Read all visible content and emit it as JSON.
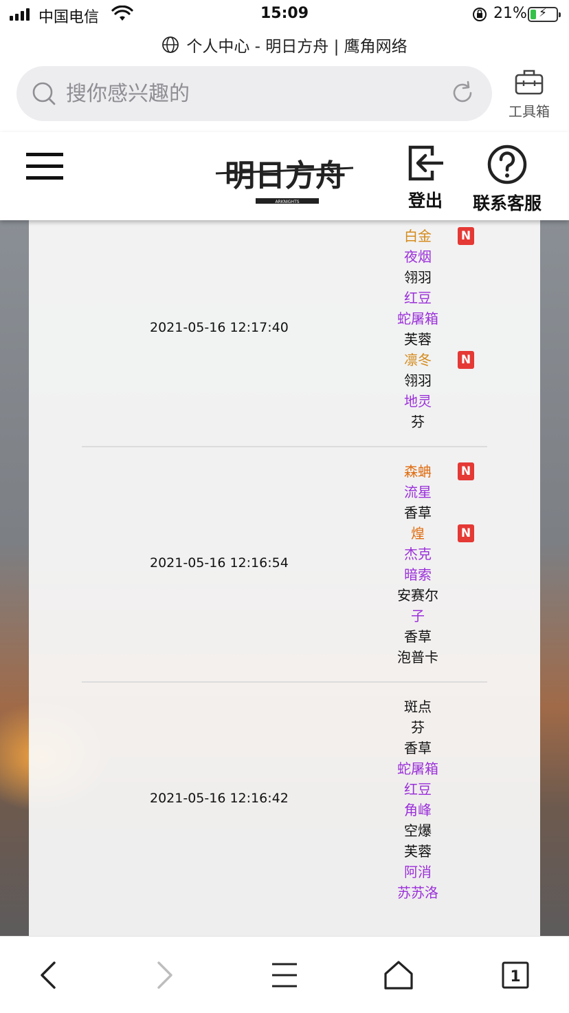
{
  "status_bar": {
    "carrier": "中国电信",
    "time": "15:09",
    "battery": "21%",
    "battery_level": 0.21
  },
  "browser": {
    "page_title": "个人中心 - 明日方舟 | 鹰角网络",
    "search_placeholder": "搜你感兴趣的",
    "toolbox_label": "工具箱"
  },
  "header": {
    "logo_text": "明日方舟",
    "logo_subtext": "ARKNIGHTS",
    "logout_label": "登出",
    "service_label": "联系客服"
  },
  "rarity_colors": {
    "3": "#111111",
    "4": "#9b30d9",
    "5": "#d48a1a",
    "6": "#e06d10"
  },
  "records": [
    {
      "time": "2021-05-16 12:17:40",
      "operators": [
        {
          "name": "白金",
          "rarity": 5,
          "new": true
        },
        {
          "name": "夜烟",
          "rarity": 4,
          "new": false
        },
        {
          "name": "翎羽",
          "rarity": 3,
          "new": false
        },
        {
          "name": "红豆",
          "rarity": 4,
          "new": false
        },
        {
          "name": "蛇屠箱",
          "rarity": 4,
          "new": false
        },
        {
          "name": "芙蓉",
          "rarity": 3,
          "new": false
        },
        {
          "name": "凛冬",
          "rarity": 5,
          "new": true
        },
        {
          "name": "翎羽",
          "rarity": 3,
          "new": false
        },
        {
          "name": "地灵",
          "rarity": 4,
          "new": false
        },
        {
          "name": "芬",
          "rarity": 3,
          "new": false
        }
      ]
    },
    {
      "time": "2021-05-16 12:16:54",
      "operators": [
        {
          "name": "森蚺",
          "rarity": 6,
          "new": true
        },
        {
          "name": "流星",
          "rarity": 4,
          "new": false
        },
        {
          "name": "香草",
          "rarity": 3,
          "new": false
        },
        {
          "name": "煌",
          "rarity": 6,
          "new": true
        },
        {
          "name": "杰克",
          "rarity": 4,
          "new": false
        },
        {
          "name": "暗索",
          "rarity": 4,
          "new": false
        },
        {
          "name": "安赛尔",
          "rarity": 3,
          "new": false
        },
        {
          "name": "子",
          "rarity": 4,
          "new": false
        },
        {
          "name": "香草",
          "rarity": 3,
          "new": false
        },
        {
          "name": "泡普卡",
          "rarity": 3,
          "new": false
        }
      ]
    },
    {
      "time": "2021-05-16 12:16:42",
      "operators": [
        {
          "name": "斑点",
          "rarity": 3,
          "new": false
        },
        {
          "name": "芬",
          "rarity": 3,
          "new": false
        },
        {
          "name": "香草",
          "rarity": 3,
          "new": false
        },
        {
          "name": "蛇屠箱",
          "rarity": 4,
          "new": false
        },
        {
          "name": "红豆",
          "rarity": 4,
          "new": false
        },
        {
          "name": "角峰",
          "rarity": 4,
          "new": false
        },
        {
          "name": "空爆",
          "rarity": 3,
          "new": false
        },
        {
          "name": "芙蓉",
          "rarity": 3,
          "new": false
        },
        {
          "name": "阿消",
          "rarity": 4,
          "new": false
        },
        {
          "name": "苏苏洛",
          "rarity": 4,
          "new": false
        }
      ]
    }
  ],
  "new_badge_label": "N",
  "bottom_bar": {
    "tab_count": "1"
  }
}
